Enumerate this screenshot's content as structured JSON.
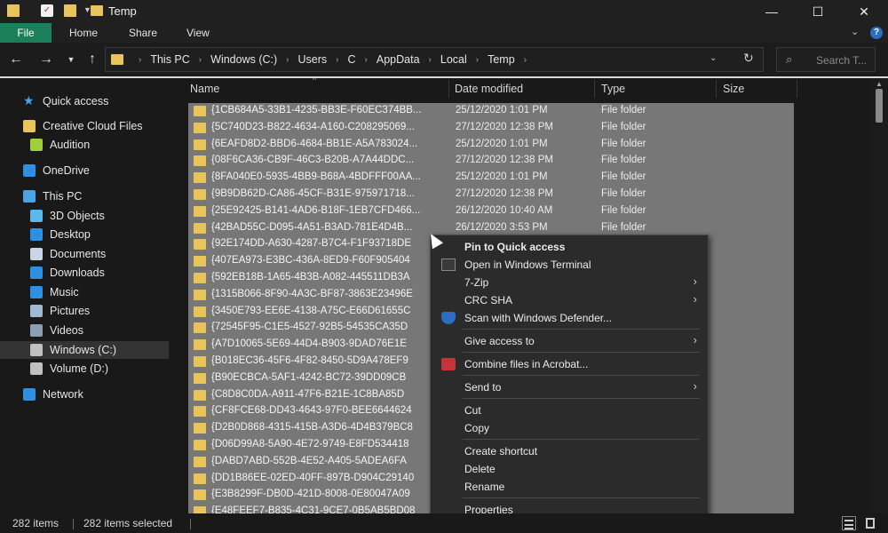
{
  "window": {
    "title": "Temp",
    "minimize_glyph": "—",
    "maximize_glyph": "☐",
    "close_glyph": "✕"
  },
  "ribbon": {
    "file": "File",
    "tabs": [
      "Home",
      "Share",
      "View"
    ]
  },
  "address": {
    "crumbs": [
      "This PC",
      "Windows (C:)",
      "Users",
      "C",
      "AppData",
      "Local",
      "Temp"
    ],
    "search_placeholder": "Search T..."
  },
  "nav": {
    "quick_access": "Quick access",
    "items": [
      {
        "label": "Creative Cloud Files",
        "icon": "creative-cloud-icon",
        "color": "#e8c45a"
      },
      {
        "label": "Audition",
        "icon": "audition-icon",
        "color": "#9fcf3a"
      },
      {
        "label": "OneDrive",
        "icon": "onedrive-icon",
        "color": "#2f8fe0"
      },
      {
        "label": "This PC",
        "icon": "this-pc-icon",
        "color": "#4ba3e6"
      },
      {
        "label": "3D Objects",
        "icon": "3d-objects-icon",
        "color": "#5bb8e8"
      },
      {
        "label": "Desktop",
        "icon": "desktop-icon",
        "color": "#2f8fe0"
      },
      {
        "label": "Documents",
        "icon": "documents-icon",
        "color": "#c8d6e6"
      },
      {
        "label": "Downloads",
        "icon": "downloads-icon",
        "color": "#2f8fe0"
      },
      {
        "label": "Music",
        "icon": "music-icon",
        "color": "#2f8fe0"
      },
      {
        "label": "Pictures",
        "icon": "pictures-icon",
        "color": "#9fb9d6"
      },
      {
        "label": "Videos",
        "icon": "videos-icon",
        "color": "#8a9fb6"
      },
      {
        "label": "Windows (C:)",
        "icon": "drive-c-icon",
        "color": "#c0c0c0"
      },
      {
        "label": "Volume (D:)",
        "icon": "drive-d-icon",
        "color": "#c0c0c0"
      },
      {
        "label": "Network",
        "icon": "network-icon",
        "color": "#2f8fe0"
      }
    ]
  },
  "columns": {
    "name": "Name",
    "date": "Date modified",
    "type": "Type",
    "size": "Size"
  },
  "files": [
    {
      "name": "{1CB684A5-33B1-4235-BB3E-F60EC374BB...",
      "date": "25/12/2020 1:01 PM",
      "type": "File folder"
    },
    {
      "name": "{5C740D23-B822-4634-A160-C208295069...",
      "date": "27/12/2020 12:38 PM",
      "type": "File folder"
    },
    {
      "name": "{6EAFD8D2-BBD6-4684-BB1E-A5A783024...",
      "date": "25/12/2020 1:01 PM",
      "type": "File folder"
    },
    {
      "name": "{08F6CA36-CB9F-46C3-B20B-A7A44DDC...",
      "date": "27/12/2020 12:38 PM",
      "type": "File folder"
    },
    {
      "name": "{8FA040E0-5935-4BB9-B68A-4BDFFF00AA...",
      "date": "25/12/2020 1:01 PM",
      "type": "File folder"
    },
    {
      "name": "{9B9DB62D-CA86-45CF-B31E-975971718...",
      "date": "27/12/2020 12:38 PM",
      "type": "File folder"
    },
    {
      "name": "{25E92425-B141-4AD6-B18F-1EB7CFD466...",
      "date": "26/12/2020 10:40 AM",
      "type": "File folder"
    },
    {
      "name": "{42BAD55C-D095-4A51-B3AD-781E4D4B...",
      "date": "26/12/2020 3:53 PM",
      "type": "File folder"
    },
    {
      "name": "{92E174DD-A630-4287-B7C4-F1F93718DE",
      "date": "",
      "type": ""
    },
    {
      "name": "{407EA973-E3BC-436A-8ED9-F60F905404",
      "date": "",
      "type": ""
    },
    {
      "name": "{592EB18B-1A65-4B3B-A082-445511DB3A",
      "date": "",
      "type": ""
    },
    {
      "name": "{1315B066-8F90-4A3C-BF87-3863E23496E",
      "date": "",
      "type": ""
    },
    {
      "name": "{3450E793-EE6E-4138-A75C-E66D61655C",
      "date": "",
      "type": ""
    },
    {
      "name": "{72545F95-C1E5-4527-92B5-54535CA35D",
      "date": "",
      "type": ""
    },
    {
      "name": "{A7D10065-5E69-44D4-B903-9DAD76E1E",
      "date": "",
      "type": ""
    },
    {
      "name": "{B018EC36-45F6-4F82-8450-5D9A478EF9",
      "date": "",
      "type": ""
    },
    {
      "name": "{B90ECBCA-5AF1-4242-BC72-39DD09CB",
      "date": "",
      "type": ""
    },
    {
      "name": "{C8D8C0DA-A911-47F6-B21E-1C8BA85D",
      "date": "",
      "type": ""
    },
    {
      "name": "{CF8FCE68-DD43-4643-97F0-BEE6644624",
      "date": "",
      "type": ""
    },
    {
      "name": "{D2B0D868-4315-415B-A3D6-4D4B379BC8",
      "date": "",
      "type": ""
    },
    {
      "name": "{D06D99A8-5A90-4E72-9749-E8FD534418",
      "date": "",
      "type": ""
    },
    {
      "name": "{DABD7ABD-552B-4E52-A405-5ADEA6FA",
      "date": "",
      "type": ""
    },
    {
      "name": "{DD1B86EE-02ED-40FF-897B-D904C29140",
      "date": "",
      "type": ""
    },
    {
      "name": "{E3B8299F-DB0D-421D-8008-0E80047A09",
      "date": "",
      "type": ""
    },
    {
      "name": "{E48FEEF7-B835-4C31-9CE7-0B5AB5BD08",
      "date": "",
      "type": ""
    }
  ],
  "context_menu": [
    {
      "label": "Pin to Quick access",
      "bold": true
    },
    {
      "label": "Open in Windows Terminal",
      "icon": "terminal-icon"
    },
    {
      "label": "7-Zip",
      "submenu": true
    },
    {
      "label": "CRC SHA",
      "submenu": true
    },
    {
      "label": "Scan with Windows Defender...",
      "icon": "defender-shield-icon"
    },
    {
      "label": "Give access to",
      "submenu": true
    },
    {
      "label": "Combine files in Acrobat...",
      "icon": "acrobat-icon"
    },
    {
      "label": "Send to",
      "submenu": true
    },
    {
      "label": "Cut"
    },
    {
      "label": "Copy"
    },
    {
      "label": "Create shortcut"
    },
    {
      "label": "Delete"
    },
    {
      "label": "Rename"
    },
    {
      "label": "Properties"
    }
  ],
  "status": {
    "items": "282 items",
    "selected": "282 items selected"
  },
  "colors": {
    "accent_file_tab": "#1a7f5a",
    "folder": "#e8c45a",
    "selection": "#777777",
    "background": "#191919"
  }
}
